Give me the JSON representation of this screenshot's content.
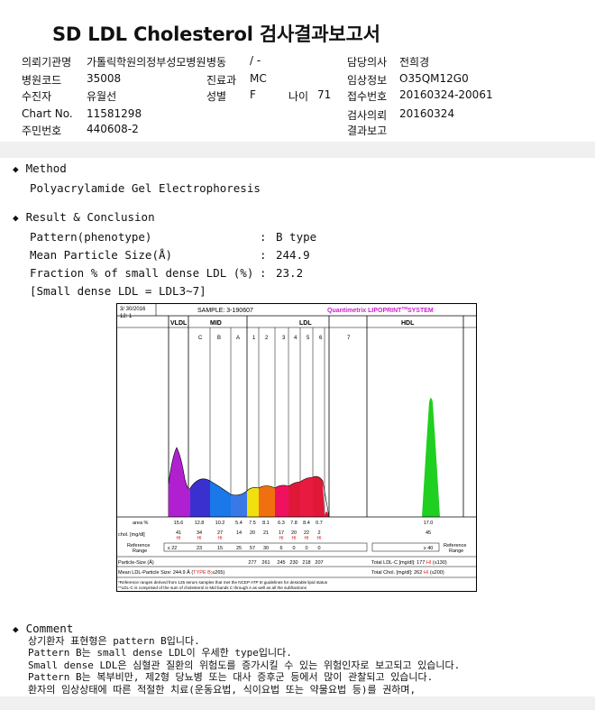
{
  "report": {
    "title": "SD LDL Cholesterol 검사결과보고서",
    "hospital_label": "의뢰기관명",
    "hospital_value": "가톨릭학원의정부성모병원",
    "ward_label": "병동",
    "ward_value": "/ -",
    "doctor_label": "담당의사",
    "doctor_value": "전희경",
    "hospital_code_label": "병원코드",
    "hospital_code_value": "35008",
    "dept_label": "진료과",
    "dept_value": "MC",
    "clinical_label": "임상정보",
    "clinical_value": "O35QM12G0",
    "patient_label": "수진자",
    "patient_value": "유월선",
    "sex_label": "성별",
    "sex_value": "F",
    "age_label": "나이",
    "age_value": "71",
    "receipt_label": "접수번호",
    "receipt_value": "20160324-20061",
    "chart_label": "Chart No.",
    "chart_value": "11581298",
    "test_request_label": "검사의뢰",
    "test_request_value": "20160324",
    "resident_label": "주민번호",
    "resident_value": "440608-2",
    "result_report_label": "결과보고",
    "result_report_value": ""
  },
  "method": {
    "heading": "Method",
    "text": "Polyacrylamide Gel Electrophoresis"
  },
  "result": {
    "heading": "Result & Conclusion",
    "pattern_label": "Pattern(phenotype)",
    "pattern_value": "B type",
    "size_label": "Mean Particle Size(Å)",
    "size_value": "244.9",
    "fraction_label": "Fraction % of small dense LDL (%)",
    "fraction_value": "23.2",
    "note": "[Small dense LDL = LDL3~7]",
    "colon": ":"
  },
  "lipoprint": {
    "date": "3/ 30/2016",
    "time": "12: 1",
    "sample": "SAMPLE:  3-190607",
    "brand": "Quantimetrix LIPOPRINT",
    "brand_sup": "TM",
    "brand_tail": "SYSTEM",
    "band_headers": [
      "VLDL",
      "MID",
      "LDL",
      "HDL"
    ],
    "mid_bands": [
      "C",
      "B",
      "A"
    ],
    "ldl_bands": [
      "1",
      "2",
      "3",
      "4",
      "5",
      "6",
      "7"
    ],
    "row_area_label": "area %",
    "area_values": [
      "15.6",
      "12.8",
      "10.2",
      "5.4",
      "7.5",
      "8.1",
      "6.3",
      "7.8",
      "8.4",
      "0.7",
      "17.0"
    ],
    "row_chol_label": "chol. [mg/dl]",
    "chol_values": [
      "41",
      "34",
      "27",
      "14",
      "20",
      "21",
      "17",
      "20",
      "22",
      "2",
      "45"
    ],
    "chol_flags": [
      "HI",
      "HI",
      "HI",
      "",
      "",
      "",
      "HI",
      "HI",
      "HI",
      "HI",
      ""
    ],
    "row_ref_label": "Reference Range",
    "ref_values": [
      "≤ 22",
      "23",
      "15",
      "25",
      "57",
      "30",
      "6",
      "0",
      "0",
      "0",
      "≥ 40"
    ],
    "ref_right_label": "Reference Range",
    "particle_label": "Particle-Size (Å)",
    "particle_values": [
      "277",
      "261",
      "245",
      "230",
      "218",
      "207"
    ],
    "total_ldl": "Total LDL-C [mg/dl]:  177",
    "total_ldl_flag": "HI",
    "total_ldl_ref": "(≤130)",
    "mean_size": "Mean LDL-Particle Size:  244.9 Å",
    "mean_size_type": "TYPE B",
    "mean_size_tail": ";≤265)",
    "total_chol": "Total Chol. [mg/dl]:  262",
    "total_chol_flag": "HI",
    "total_chol_ref": "(≤200)",
    "footnote1": "*Reference ranges derived from 125 serum samples that met the NCEP ATP III guidelines for desirable lipid status",
    "footnote2": "**LDL-C is comprised of the sum of cholesterol in Mid bands C through A as well as all the subfractions",
    "colors": {
      "vldl": "#b020d0",
      "midc": "#3a30d0",
      "midb": "#1a78e8",
      "mida": "#3a78e8",
      "ldl1": "#f0e010",
      "ldl2": "#f07010",
      "ldl3": "#f01060",
      "ldl4": "#e01838",
      "hdl": "#20d020",
      "brand": "#d020d0",
      "hi": "#e02020"
    }
  },
  "comment": {
    "heading": "Comment",
    "lines": [
      "상기환자 표현형은 pattern B입니다.",
      "Pattern B는 small dense LDL이 우세한 type입니다.",
      "Small dense LDL은 심혈관 질환의 위험도를 증가시킬 수 있는 위험인자로 보고되고 있습니다.",
      "Pattern B는 복부비만, 제2형 당뇨병 또는 대사 증후군 등에서 많이 관찰되고 있습니다.",
      "환자의 임상상태에 따른 적절한 치료(운동요법, 식이요법 또는 약물요법 등)를 권하며,"
    ]
  }
}
